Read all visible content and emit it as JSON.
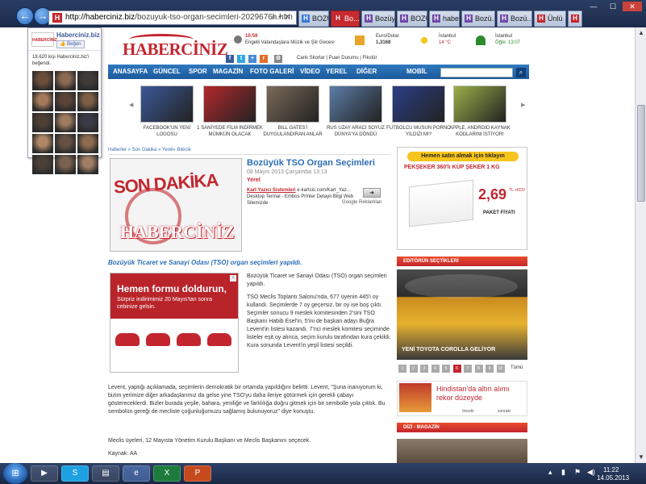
{
  "browser": {
    "url_host": "http://haberciniz.biz",
    "url_path": "/bozuyuk-tso-organ-secimleri-2029676h.htm",
    "tabs": [
      {
        "label": "BOZÜ...",
        "active": false,
        "color": "#3a7bd5"
      },
      {
        "label": "Bo...",
        "active": true,
        "color": "#c3262f"
      },
      {
        "label": "Bozüy...",
        "active": false,
        "color": "#6f4aa7"
      },
      {
        "label": "BOZÜ...",
        "active": false,
        "color": "#6f4aa7"
      },
      {
        "label": "haber...",
        "active": false,
        "color": "#6f4aa7"
      },
      {
        "label": "Bozü...",
        "active": false,
        "color": "#6f4aa7"
      },
      {
        "label": "Bozü...",
        "active": false,
        "color": "#6f4aa7"
      },
      {
        "label": "Ünlü ...",
        "active": false,
        "color": "#c3262f"
      },
      {
        "label": "Bozü...",
        "active": false,
        "color": "#c3262f"
      }
    ]
  },
  "fb": {
    "name": "Haberciniz.biz",
    "like": "Beğen",
    "count_text": "18.620 kişi Haberciniz.biz'i beğendi.",
    "logo_text": "HABERCİNİZ"
  },
  "header": {
    "logo": "HABERCİNİZ",
    "ticker_time": "10:59",
    "ticker_text": "Engelli Vatandaşlara Müzik ve Şiir Gecesi",
    "currency_label": "Euro/Dolar",
    "currency_value": "1,3168",
    "weather": [
      {
        "city": "İstanbul",
        "value": "14 °C",
        "green": false
      },
      {
        "city": "İstanbul",
        "value": "Öğle: 13:07",
        "green": true
      }
    ],
    "subnav": "Canlı Skorlar  |  Puan Durumu  |  Fikstür"
  },
  "nav": [
    "ANASAYFA",
    "GÜNCEL",
    "SPOR",
    "MAGAZİN",
    "FOTO GALERİ",
    "VİDEO",
    "YEREL",
    "DİĞER",
    "MOBİL"
  ],
  "thumbs": [
    {
      "caption": "FACEBOOK'UN YENİ LOGOSU",
      "color": "#3b5998"
    },
    {
      "caption": "1 SANİYEDE FİLM İNDİRMEK MÜMKÜN OLACAK",
      "color": "#b2282c"
    },
    {
      "caption": "BILL GATES'İ DUYGULANDIRAN ANLAR",
      "color": "#7b6a58"
    },
    {
      "caption": "RUS UZAY ARACI SOYUZ DÜNYA'YA DÖNDÜ",
      "color": "#5b7ca6"
    },
    {
      "caption": "FUTBOLCU MUSUN PORNO YILDIZI MI?",
      "color": "#2b3f86"
    },
    {
      "caption": "APPLE, ANDROID KAYNAK KODLARINI İSTİYOR!",
      "color": "#9ab04a"
    }
  ],
  "breadcrumb": "Haberler » Son Dakika » Yerel» Bilecik",
  "article": {
    "image_title": "SON DAKİKA",
    "image_logo": "HABERCİNİZ",
    "title": "Bozüyük TSO Organ Seçimleri",
    "date": "08 Mayıs 2013 Çarşamba 13:13",
    "category": "Yerel",
    "lead": "Bozüyük Ticaret ve Sanayi Odası (TSO) organ seçimleri yapıldı.",
    "p1": "Bozüyük Ticaret ve Sanayi Odası (TSO) organ seçimleri yapıldı.",
    "p2": "TSO Meclis Toplantı Salonu'nda, 677 üyenin 445'i oy kullandı. Seçimlerde 7 oy geçersiz, bir oy ise boş çıktı. Seçimler sonucu 9 meslek komitesinden 2'sini TSO Başkanı Habib Esel'in, 5'ini de başkan adayı Buğra Levent'in listesi kazandı. 7'nci meslek komitesi seçiminde listeler eşit oy alınca, seçim kurulu tarafından kura çekildi. Kura sonunda Levent'in yeşil listesi seçildi.",
    "p3": "Levent, yaptığı açıklamada, seçimlerin demokratik bir ortamda yapıldığını belirtti. Levent, \"Şuna inanıyorum ki, bizim yerimize diğer arkadaşlarımız da gelse yine TSO'yu daha ileriye götürmek için gerekli çabayı göstereceklerdi. Bizler burada yeşile, bahara, yeniliğe ve farklılığa doğru gitmek için bir sembolle yola çıktık. Bu sembolün gereği de mecliste çoğunluğumuzu sağlamış bulunuyoruz\" diye konuştu.",
    "p4": "Meclis üyeleri, 12 Mayısta Yönetim Kurulu Başkanı ve Meclis Başkanını seçecek.",
    "source": "Kaynak: AA"
  },
  "textad": {
    "link": "Kart Yazıcı Sistemleri",
    "domain": "e-kartsis.com/Kart_Yaz...",
    "desc": "Desktop Termal - Embos Printer Detaylı Bilgi Web Sitemizde",
    "arrow": "➜",
    "google": "Google Reklamları"
  },
  "ad2": {
    "headline": "Hemen formu doldurun,",
    "sub": "Sürpriz indirimimiz 20 Mayıs'tan sonra cebinize gelsin."
  },
  "ad_right": {
    "banner": "Hemen satın almak için tıklayın",
    "headline": "PEKŞEKER 360'lı KÜP ŞEKER 1 KG",
    "price": "2,69",
    "price_unit": "TL +KDV",
    "paket": "PAKET FİYATI"
  },
  "editor": {
    "heading": "EDİTÖRÜN SEÇTİKLERİ",
    "caption": "YENİ TOYOTA COROLLA GELİYOR",
    "pages": [
      "1",
      "2",
      "3",
      "4",
      "5",
      "6",
      "7",
      "8",
      "9",
      "10"
    ],
    "active_page": 6,
    "all_label": "Tümü"
  },
  "news2": {
    "title": "Hindistan'da altın alımı rekor düzeyde",
    "prev": "önceki",
    "next": "sonraki"
  },
  "magazin_heading": "DİZİ - MAGAZİN",
  "taskbar": {
    "time": "11:22",
    "date": "14.05.2013"
  }
}
